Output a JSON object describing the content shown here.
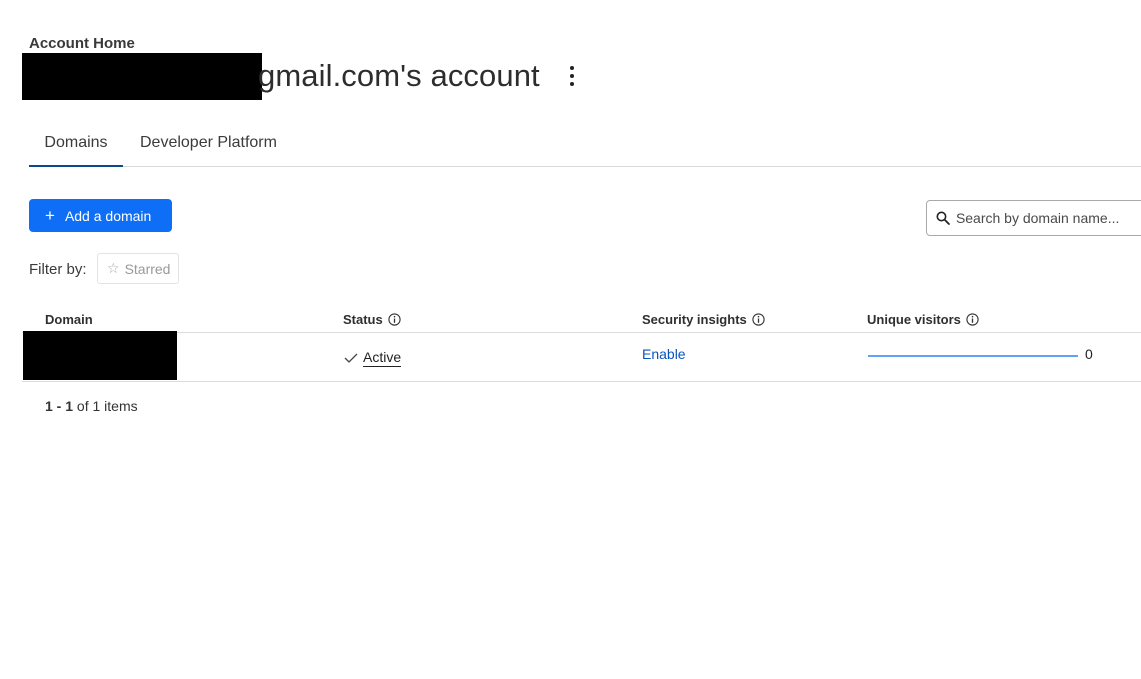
{
  "header": {
    "breadcrumb": "Account Home",
    "account_title": "gmail.com's account"
  },
  "tabs": [
    {
      "label": "Domains",
      "active": true
    },
    {
      "label": "Developer Platform",
      "active": false
    }
  ],
  "toolbar": {
    "add_domain_icon": "+",
    "add_domain_label": "Add a domain",
    "search_placeholder": "Search by domain name..."
  },
  "filter": {
    "label": "Filter by:",
    "starred_icon": "☆",
    "starred_label": "Starred"
  },
  "table": {
    "headers": {
      "domain": "Domain",
      "status": "Status",
      "security": "Security insights",
      "visitors": "Unique visitors"
    },
    "rows": [
      {
        "status": "Active",
        "security_action": "Enable",
        "unique_visitors": "0"
      }
    ]
  },
  "pagination": {
    "range": "1 - 1",
    "of_text": "of",
    "total": "1",
    "items_text": "items"
  },
  "colors": {
    "accent": "#0e6ff6",
    "link": "#0a55bd",
    "tab_underline": "#0a4a8c"
  }
}
